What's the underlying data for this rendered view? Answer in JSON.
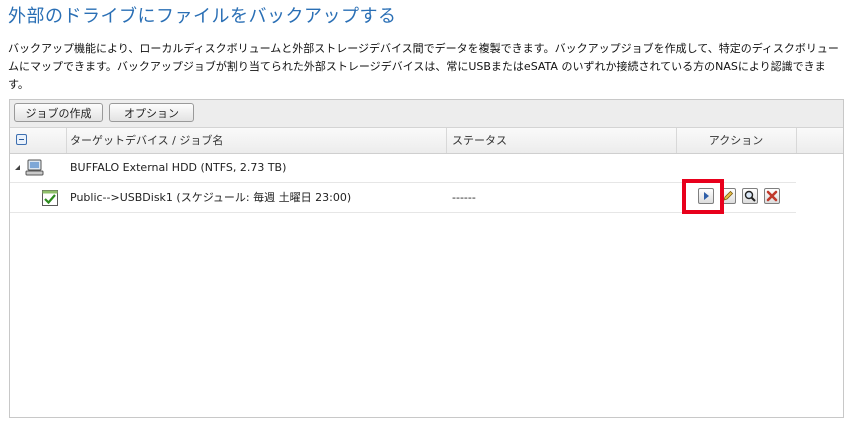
{
  "page": {
    "title": "外部のドライブにファイルをバックアップする",
    "description": "バックアップ機能により、ローカルディスクボリュームと外部ストレージデバイス間でデータを複製できます。バックアップジョブを作成して、特定のディスクボリュームにマップできます。バックアップジョブが割り当てられた外部ストレージデバイスは、常にUSBまたはeSATA のいずれか接続されている方のNASにより認識できます。"
  },
  "toolbar": {
    "create_job": "ジョブの作成",
    "options": "オプション"
  },
  "table": {
    "columns": {
      "target": "ターゲットデバイス / ジョブ名",
      "status": "ステータス",
      "action": "アクション"
    },
    "device": {
      "name": "BUFFALO External HDD (NTFS, 2.73 TB)"
    },
    "job": {
      "name": "Public-->USBDisk1 (スケジュール: 毎週 土曜日 23:00)",
      "status": "------"
    }
  },
  "colors": {
    "title": "#2a6fb5",
    "highlight": "#e8001c",
    "delete": "#c0392b"
  },
  "icons": [
    "collapse-icon",
    "expand-triangle-icon",
    "computer-icon",
    "job-check-icon",
    "play-icon",
    "edit-icon",
    "search-icon",
    "delete-icon"
  ]
}
